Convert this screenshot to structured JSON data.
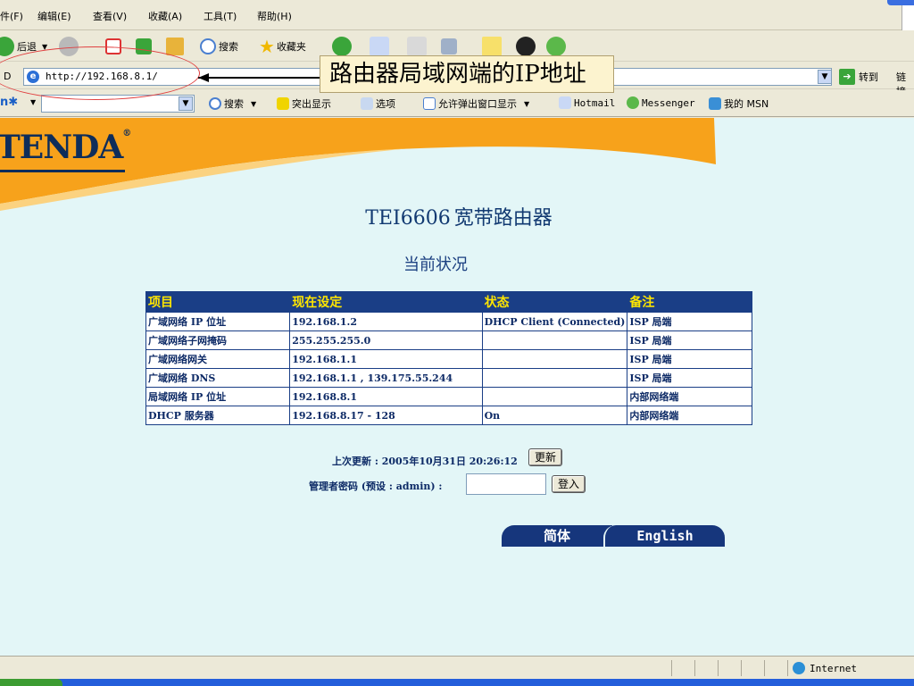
{
  "menu": {
    "items": [
      "件(F)",
      "编辑(E)",
      "查看(V)",
      "收藏(A)",
      "工具(T)",
      "帮助(H)"
    ]
  },
  "toolbar": {
    "back": "后退",
    "search": "搜索",
    "favorites": "收藏夹"
  },
  "address": {
    "label": "D",
    "url": "http://192.168.8.1/",
    "go": "转到",
    "links": "链接"
  },
  "linksbar": {
    "search": "搜索",
    "highlight": "突出显示",
    "options": "选项",
    "popups": "允许弹出窗口显示",
    "hotmail": "Hotmail",
    "messenger": "Messenger",
    "mymsn": "我的 MSN"
  },
  "annotation": {
    "text": "路由器局域网端的IP地址"
  },
  "page": {
    "logo": "TENDA",
    "logo_mark": "®",
    "title_model": "TEI6606",
    "title_text": "宽带路由器",
    "subtitle": "当前状况"
  },
  "table": {
    "headers": [
      "项目",
      "现在设定",
      "状态",
      "备注"
    ],
    "rows": [
      [
        "广域网络 IP 位址",
        "192.168.1.2",
        "DHCP Client (Connected)",
        "ISP 局端"
      ],
      [
        "广域网络子网掩码",
        "255.255.255.0",
        "",
        "ISP 局端"
      ],
      [
        "广域网络网关",
        "192.168.1.1",
        "",
        "ISP 局端"
      ],
      [
        "广域网络 DNS",
        "192.168.1.1 , 139.175.55.244",
        "",
        "ISP 局端"
      ],
      [
        "局域网络 IP 位址",
        "192.168.8.1",
        "",
        "内部网络端"
      ],
      [
        "DHCP 服务器",
        "192.168.8.17 - 128",
        "On",
        "内部网络端"
      ]
    ]
  },
  "form": {
    "last_update": "上次更新 : 2005年10月31日 20:26:12",
    "update_button": "更新",
    "password_label": "管理者密码 (预设 : admin) :",
    "password_value": "",
    "login_button": "登入"
  },
  "language": {
    "simplified": "简体",
    "english": "English"
  },
  "statusbar": {
    "zone": "Internet"
  },
  "colors": {
    "page_bg": "#e3f6f7",
    "banner_orange": "#f7a21b",
    "table_header_bg": "#1a3e86",
    "table_header_text": "#ffe600",
    "table_text": "#0d2a66"
  }
}
